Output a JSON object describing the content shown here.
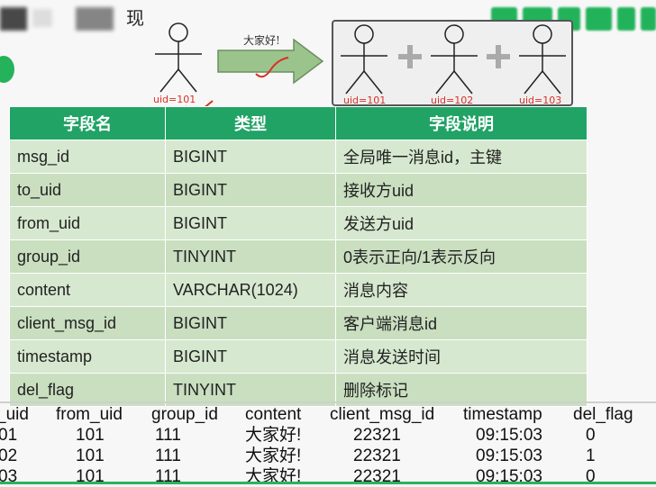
{
  "header": {
    "title_char": "现",
    "arrow_label": "大家好!",
    "sender_uid": "uid=101",
    "group_uids": [
      "uid=101",
      "uid=102",
      "uid=103"
    ]
  },
  "colors": {
    "table_header": "#21a366",
    "row_light": "#d6e8cf",
    "row_dark": "#c9dfc0",
    "annotation": "#d93025"
  },
  "table": {
    "headers": [
      "字段名",
      "类型",
      "字段说明"
    ],
    "rows": [
      [
        "msg_id",
        "BIGINT",
        "全局唯一消息id，主键"
      ],
      [
        "to_uid",
        "BIGINT",
        "接收方uid"
      ],
      [
        "from_uid",
        "BIGINT",
        "发送方uid"
      ],
      [
        "group_id",
        "TINYINT",
        "0表示正向/1表示反向"
      ],
      [
        "content",
        "VARCHAR(1024)",
        "消息内容"
      ],
      [
        "client_msg_id",
        "BIGINT",
        "客户端消息id"
      ],
      [
        "timestamp",
        "BIGINT",
        "消息发送时间"
      ],
      [
        "del_flag",
        "TINYINT",
        "删除标记"
      ]
    ]
  },
  "data_table": {
    "headers": [
      "_uid",
      "from_uid",
      "group_id",
      "content",
      "client_msg_id",
      "timestamp",
      "del_flag"
    ],
    "rows": [
      [
        "01",
        "101",
        "111",
        "大家好!",
        "22321",
        "09:15:03",
        "0"
      ],
      [
        "02",
        "101",
        "111",
        "大家好!",
        "22321",
        "09:15:03",
        "1"
      ],
      [
        "03",
        "101",
        "111",
        "大家好!",
        "22321",
        "09:15:03",
        "0"
      ]
    ]
  }
}
